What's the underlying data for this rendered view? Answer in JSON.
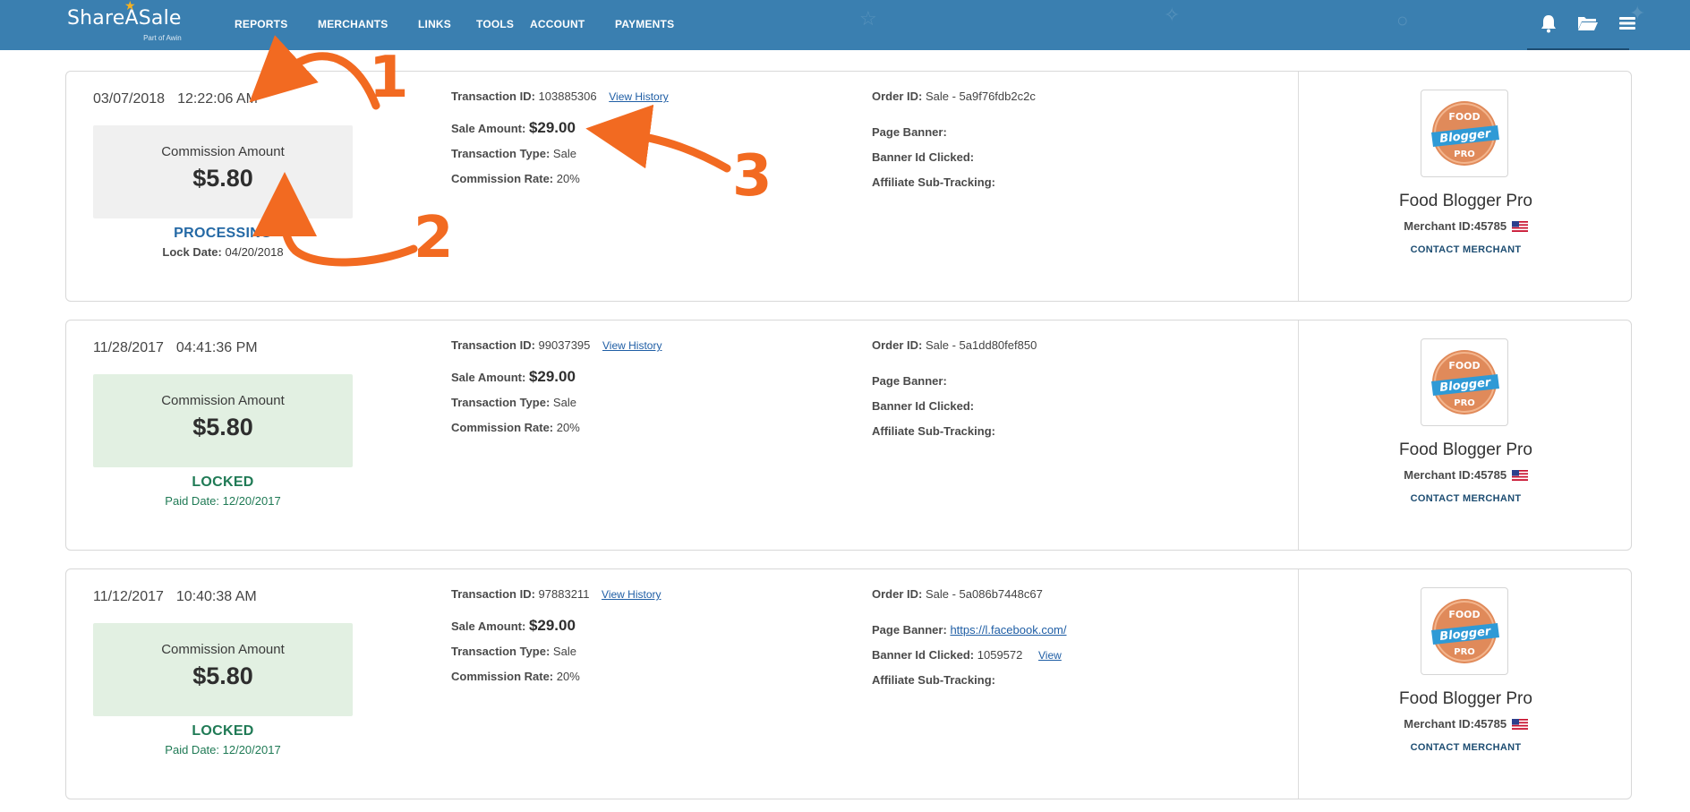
{
  "header": {
    "logo_text": "ShareASale",
    "logo_sub": "Part of Awin",
    "nav": [
      "REPORTS",
      "MERCHANTS",
      "LINKS",
      "TOOLS",
      "ACCOUNT",
      "PAYMENTS"
    ],
    "icons": [
      "bell-icon",
      "folder-icon",
      "menu-icon"
    ],
    "bar_color": "#3a7fb0"
  },
  "labels": {
    "commission_amount": "Commission Amount",
    "transaction_id": "Transaction ID:",
    "view_history": "View History",
    "sale_amount": "Sale Amount:",
    "transaction_type": "Transaction Type:",
    "commission_rate": "Commission Rate:",
    "order_id": "Order ID:",
    "page_banner": "Page Banner:",
    "banner_id_clicked": "Banner Id Clicked:",
    "affiliate_sub_tracking": "Affiliate Sub-Tracking:",
    "merchant_id": "Merchant ID:",
    "contact_merchant": "CONTACT MERCHANT",
    "view": "View"
  },
  "transactions": [
    {
      "date": "03/07/2018",
      "time": "12:22:06 AM",
      "commission": "$5.80",
      "status": "PROCESSING",
      "sub_label": "Lock Date:",
      "sub_value": "04/20/2018",
      "transaction_id": "103885306",
      "sale_amount": "$29.00",
      "transaction_type": "Sale",
      "commission_rate": "20%",
      "order_id": "Sale - 5a9f76fdb2c2c",
      "page_banner": "",
      "banner_id_clicked": "",
      "merchant_name": "Food Blogger Pro",
      "merchant_id": "45785"
    },
    {
      "date": "11/28/2017",
      "time": "04:41:36 PM",
      "commission": "$5.80",
      "status": "LOCKED",
      "sub_label": "Paid Date:",
      "sub_value": "12/20/2017",
      "transaction_id": "99037395",
      "sale_amount": "$29.00",
      "transaction_type": "Sale",
      "commission_rate": "20%",
      "order_id": "Sale - 5a1dd80fef850",
      "page_banner": "",
      "banner_id_clicked": "",
      "merchant_name": "Food Blogger Pro",
      "merchant_id": "45785"
    },
    {
      "date": "11/12/2017",
      "time": "10:40:38 AM",
      "commission": "$5.80",
      "status": "LOCKED",
      "sub_label": "Paid Date:",
      "sub_value": "12/20/2017",
      "transaction_id": "97883211",
      "sale_amount": "$29.00",
      "transaction_type": "Sale",
      "commission_rate": "20%",
      "order_id": "Sale - 5a086b7448c67",
      "page_banner": "https://l.facebook.com/",
      "banner_id_clicked": "1059572",
      "merchant_name": "Food Blogger Pro",
      "merchant_id": "45785"
    }
  ],
  "merchant_logo": {
    "line1": "FOOD",
    "line2": "Blogger",
    "line3": "PRO"
  },
  "annotations": [
    "1",
    "2",
    "3"
  ],
  "colors": {
    "processing": "#2469a5",
    "locked": "#1f7a55",
    "locked_bg": "#e2f0e2",
    "processing_bg": "#f0f0f0",
    "annotation": "#f26a21",
    "link": "#1f5ea5"
  }
}
